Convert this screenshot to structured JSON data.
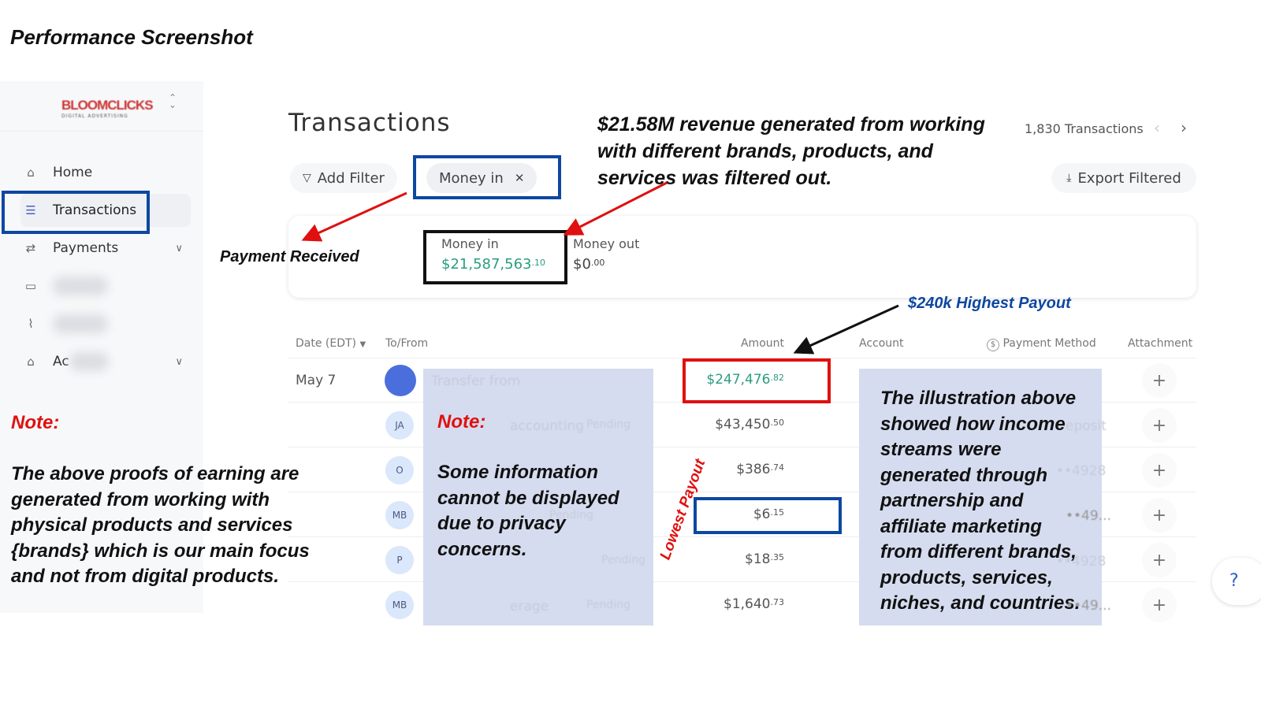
{
  "heading": "Performance Screenshot",
  "sidebar": {
    "logo_text": "BLOOMCLICKS",
    "logo_sub": "DIGITAL ADVERTISING",
    "items": [
      {
        "label": "Home",
        "icon": "home-icon"
      },
      {
        "label": "Transactions",
        "icon": "list-icon"
      },
      {
        "label": "Payments",
        "icon": "transfer-icon"
      },
      {
        "label": "",
        "icon": "card-icon"
      },
      {
        "label": "",
        "icon": "chart-icon"
      },
      {
        "label": "Ac",
        "icon": "bank-icon"
      }
    ]
  },
  "left_note": {
    "title": "Note:",
    "lines": [
      "The above proofs of earning are",
      "generated from working with",
      "physical products and services",
      "{brands} which is our main focus",
      "and not from digital products."
    ]
  },
  "main": {
    "title": "Transactions",
    "add_filter": "Add Filter",
    "filter_chip": "Money in",
    "transactions_count": "1,830 Transactions",
    "export": "Export Filtered",
    "summary": {
      "money_in_label": "Money in",
      "money_in_value": "$21,587,563",
      "money_in_cents": ".10",
      "money_out_label": "Money out",
      "money_out_value": "$0",
      "money_out_cents": ".00"
    },
    "columns": [
      "Date (EDT)",
      "To/From",
      "Amount",
      "Account",
      "Payment Method",
      "Attachment"
    ],
    "rows": [
      {
        "date": "May 7",
        "avatar": "",
        "name": "Transfer from",
        "amount": "$247,476",
        "cents": ".82",
        "account": "",
        "method": ""
      },
      {
        "date": "",
        "avatar": "JA",
        "name": "accounting",
        "status": "Pending",
        "amount": "$43,450",
        "cents": ".50",
        "account": "",
        "method": "eposit"
      },
      {
        "date": "",
        "avatar": "O",
        "name": "",
        "amount": "$386",
        "cents": ".74",
        "account": "",
        "method": "••4928"
      },
      {
        "date": "",
        "avatar": "MB",
        "name": "",
        "status": "Pending",
        "amount": "$6",
        "cents": ".15",
        "account": "",
        "method": "••49..."
      },
      {
        "date": "",
        "avatar": "P",
        "name": "",
        "status": "Pending",
        "amount": "$18",
        "cents": ".35",
        "account": "",
        "method": "••4928"
      },
      {
        "date": "",
        "avatar": "MB",
        "name": "erage",
        "status": "Pending",
        "amount": "$1,640",
        "cents": ".73",
        "account": "",
        "method": "••49..."
      }
    ]
  },
  "annotations": {
    "revenue": [
      "$21.58M revenue generated from working",
      "with different brands, products, and",
      "services was filtered out."
    ],
    "payment_received": "Payment Received",
    "highest": "$240k Highest Payout",
    "lowest": "Lowest Payout",
    "privacy_title": "Note:",
    "privacy": [
      "Some information",
      "cannot be displayed",
      "due to privacy",
      "concerns."
    ],
    "illustration": [
      "The illustration above",
      "showed how income",
      "streams were",
      "generated through",
      "partnership and",
      "affiliate marketing",
      "from different brands,",
      "products, services,",
      "niches, and countries."
    ]
  },
  "help_icon": "?",
  "colors": {
    "green": "#2a9d7f",
    "red": "#e01010",
    "blue": "#0d47a1",
    "overlay": "#d5dcef"
  }
}
